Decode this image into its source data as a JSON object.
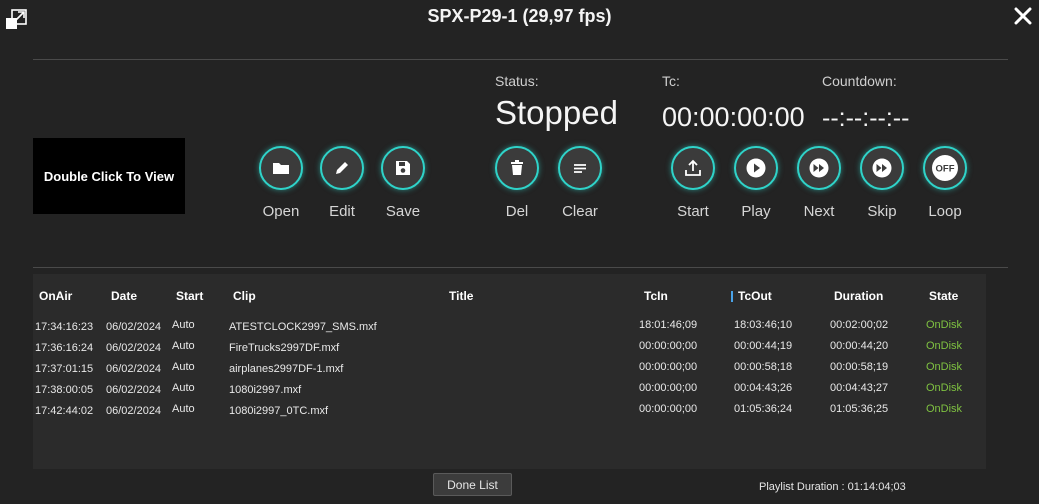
{
  "window": {
    "title": "SPX-P29-1 (29,97 fps)",
    "expand_icon": "expand-icon",
    "close_icon": "close-icon"
  },
  "preview": {
    "label": "Double Click To View"
  },
  "status": {
    "status_label": "Status:",
    "status_value": "Stopped",
    "tc_label": "Tc:",
    "tc_value": "00:00:00:00",
    "countdown_label": "Countdown:",
    "countdown_value": "--:--:--:--"
  },
  "controls": [
    {
      "label": "Open",
      "icon": "folder-icon"
    },
    {
      "label": "Edit",
      "icon": "pencil-icon"
    },
    {
      "label": "Save",
      "icon": "floppy-disk-icon"
    },
    {
      "label": "Del",
      "icon": "trash-icon"
    },
    {
      "label": "Clear",
      "icon": "clear-list-icon"
    },
    {
      "label": "Start",
      "icon": "upload-icon"
    },
    {
      "label": "Play",
      "icon": "play-icon"
    },
    {
      "label": "Next",
      "icon": "fast-forward-icon"
    },
    {
      "label": "Skip",
      "icon": "skip-icon"
    },
    {
      "label": "Loop",
      "icon": "off-toggle-icon",
      "icon_text": "OFF"
    }
  ],
  "playlist": {
    "columns": [
      "OnAir",
      "Date",
      "Start",
      "Clip",
      "Title",
      "TcIn",
      "TcOut",
      "Duration",
      "State"
    ],
    "rows": [
      [
        "17:34:16:23",
        "06/02/2024",
        "Auto",
        "ATESTCLOCK2997_SMS.mxf",
        "",
        "18:01:46;09",
        "18:03:46;10",
        "00:02:00;02",
        "OnDisk"
      ],
      [
        "17:36:16:24",
        "06/02/2024",
        "Auto",
        "FireTrucks2997DF.mxf",
        "",
        "00:00:00;00",
        "00:00:44;19",
        "00:00:44;20",
        "OnDisk"
      ],
      [
        "17:37:01:15",
        "06/02/2024",
        "Auto",
        "airplanes2997DF-1.mxf",
        "",
        "00:00:00;00",
        "00:00:58;18",
        "00:00:58;19",
        "OnDisk"
      ],
      [
        "17:38:00:05",
        "06/02/2024",
        "Auto",
        "1080i2997.mxf",
        "",
        "00:00:00;00",
        "00:04:43;26",
        "00:04:43;27",
        "OnDisk"
      ],
      [
        "17:42:44:02",
        "06/02/2024",
        "Auto",
        "1080i2997_0TC.mxf",
        "",
        "00:00:00;00",
        "01:05:36;24",
        "01:05:36;25",
        "OnDisk"
      ]
    ],
    "state_color": "#7fc241"
  },
  "footer": {
    "done_label": "Done List",
    "playlist_duration": "Playlist Duration : 01:14:04;03"
  },
  "theme": {
    "accent": "#2fd3c9",
    "background": "#232323"
  }
}
